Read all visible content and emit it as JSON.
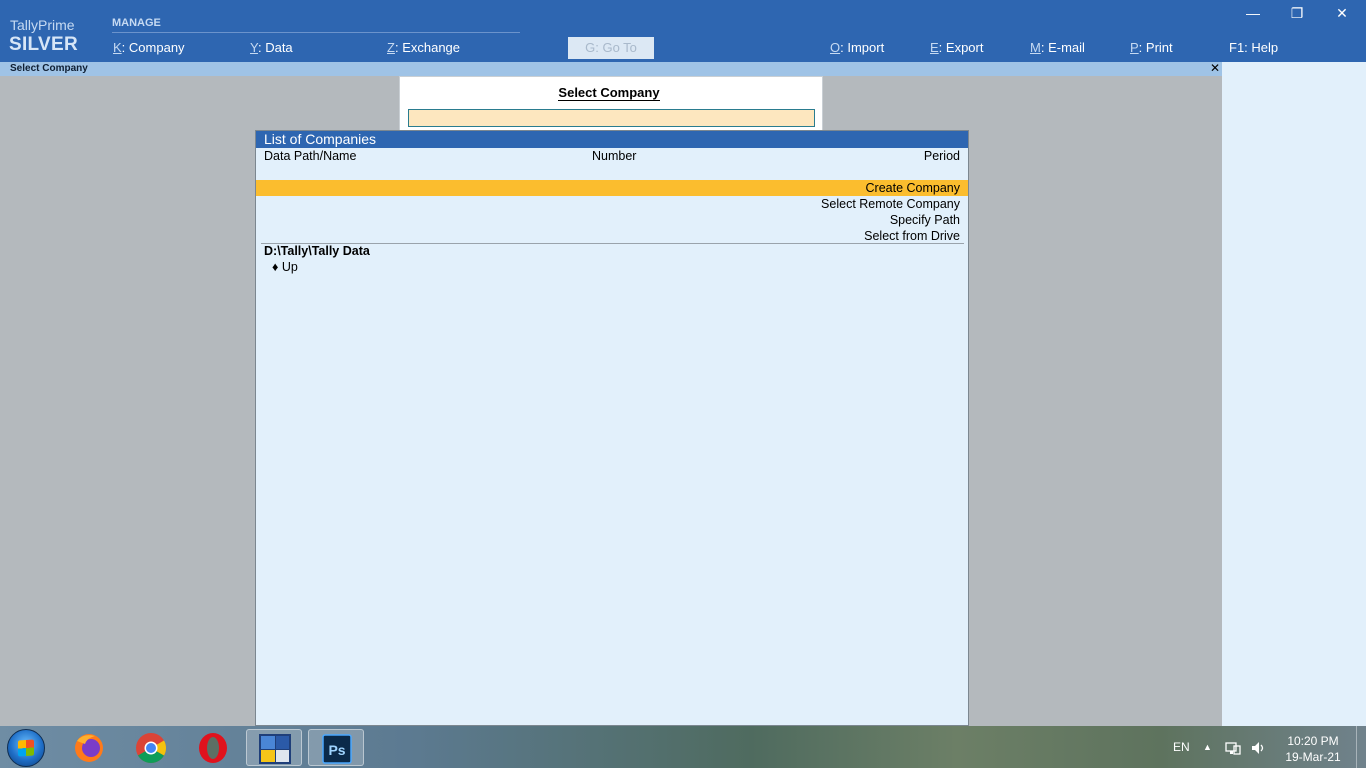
{
  "brand": {
    "line1": "TallyPrime",
    "line2": "SILVER"
  },
  "top_menu": {
    "section": "MANAGE",
    "items": [
      {
        "key": "K",
        "label": "Company"
      },
      {
        "key": "Y",
        "label": "Data"
      },
      {
        "key": "Z",
        "label": "Exchange"
      },
      {
        "key": "G",
        "label": "Go To"
      },
      {
        "key": "O",
        "label": "Import"
      },
      {
        "key": "E",
        "label": "Export"
      },
      {
        "key": "M",
        "label": "E-mail"
      },
      {
        "key": "P",
        "label": "Print"
      },
      {
        "key": "F1",
        "label": "Help"
      }
    ]
  },
  "window_controls": {
    "minimize": "—",
    "restore": "❐",
    "close": "✕"
  },
  "screen_title": "Select Company",
  "screen_close": "✕",
  "select_box": {
    "heading": "Select Company",
    "value": ""
  },
  "company_list": {
    "title": "List of Companies",
    "columns": [
      "Data Path/Name",
      "Number",
      "Period"
    ],
    "options": [
      "Create Company",
      "Select Remote Company",
      "Specify Path",
      "Select from Drive"
    ],
    "selected_option": "Create Company",
    "data_path": "D:\\Tally\\Tally Data",
    "up_bullet": "♦",
    "up_label": "Up"
  },
  "taskbar": {
    "apps": [
      "firefox-icon",
      "chrome-icon",
      "opera-icon",
      "tally-icon",
      "photoshop-icon"
    ],
    "photoshop_label": "Ps",
    "language": "EN",
    "tray_arrow": "▲",
    "time": "10:20 PM",
    "date": "19-Mar-21"
  },
  "colors": {
    "topbar": "#2e66b1",
    "panel": "#e2f0fb",
    "highlight": "#fbbd2e",
    "input_bg": "#fde7bf"
  }
}
